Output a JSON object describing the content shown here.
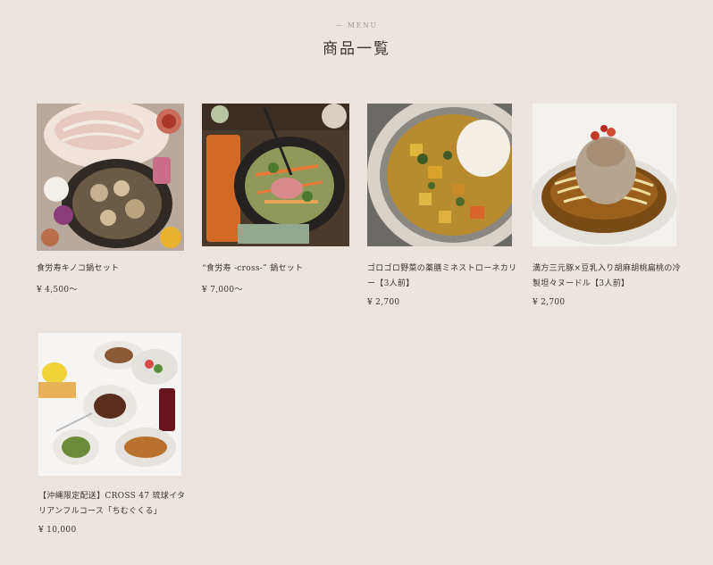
{
  "header": {
    "eyebrow": "— MENU",
    "title": "商品一覧"
  },
  "products": [
    {
      "name": "食労寿キノコ鍋セット",
      "price": "¥ 4,500〜"
    },
    {
      "name": "“食労寿 -cross-” 鍋セット",
      "price": "¥ 7,000〜"
    },
    {
      "name": "ゴロゴロ野菜の薬膳ミネストローネカリー【3人前】",
      "price": "¥ 2,700"
    },
    {
      "name": "満方三元豚×豆乳入り胡麻胡桃扁桃の冷製坦々ヌードル【3人前】",
      "price": "¥ 2,700"
    },
    {
      "name": "【沖縄限定配送】CROSS 47 琉球イタリアンフルコース「ちむぐくる」",
      "price": "¥ 10,000"
    }
  ]
}
